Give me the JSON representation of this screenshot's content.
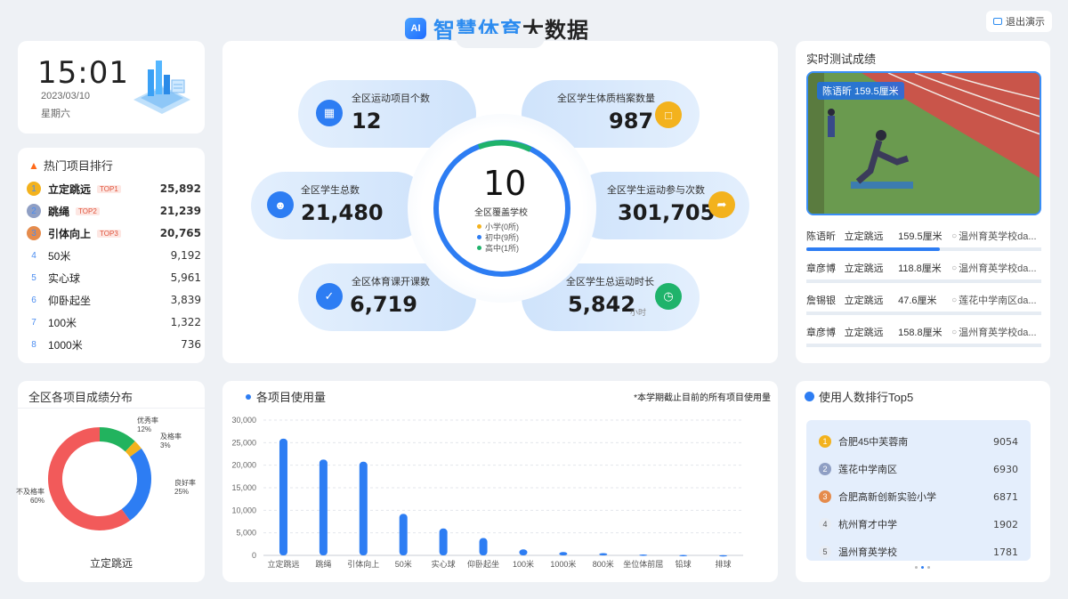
{
  "header": {
    "title_part1": "智慧体育",
    "title_part2": "大数据",
    "ai_badge": "AI",
    "exit_label": "退出演示"
  },
  "clock": {
    "time": "15:01",
    "date": "2023/03/10",
    "weekday": "星期六"
  },
  "hot_ranking": {
    "title": "热门项目排行",
    "items": [
      {
        "rank": "1",
        "name": "立定跳远",
        "tag": "TOP1",
        "value": "25,892"
      },
      {
        "rank": "2",
        "name": "跳绳",
        "tag": "TOP2",
        "value": "21,239"
      },
      {
        "rank": "3",
        "name": "引体向上",
        "tag": "TOP3",
        "value": "20,765"
      },
      {
        "rank": "4",
        "name": "50米",
        "tag": "",
        "value": "9,192"
      },
      {
        "rank": "5",
        "name": "实心球",
        "tag": "",
        "value": "5,961"
      },
      {
        "rank": "6",
        "name": "仰卧起坐",
        "tag": "",
        "value": "3,839"
      },
      {
        "rank": "7",
        "name": "100米",
        "tag": "",
        "value": "1,322"
      },
      {
        "rank": "8",
        "name": "1000米",
        "tag": "",
        "value": "736"
      }
    ],
    "medal_colors": [
      "#f3b21d",
      "#8f9fc4",
      "#e58b4c"
    ]
  },
  "stats": {
    "projects": {
      "label": "全区运动项目个数",
      "value": "12"
    },
    "archives": {
      "label": "全区学生体质档案数量",
      "value": "987"
    },
    "students": {
      "label": "全区学生总数",
      "value": "21,480"
    },
    "participation": {
      "label": "全区学生运动参与次数",
      "value": "301,705"
    },
    "pe_classes": {
      "label": "全区体育课开课数",
      "value": "6,719"
    },
    "duration": {
      "label": "全区学生总运动时长",
      "value": "5,842",
      "unit": "小时"
    },
    "coverage": {
      "value": "10",
      "label": "全区覆盖学校",
      "legend": [
        {
          "text": "小学(0所)",
          "color": "#f3b21d"
        },
        {
          "text": "初中(9所)",
          "color": "#2d7df3"
        },
        {
          "text": "高中(1所)",
          "color": "#1fb36b"
        }
      ]
    }
  },
  "realtime": {
    "title": "实时测试成绩",
    "video_label": "陈语昕  159.5厘米",
    "rows": [
      {
        "name": "陈语昕",
        "project": "立定跳远",
        "score": "159.5厘米",
        "school": "温州育英学校da...",
        "bar": 0.6
      },
      {
        "name": "章彦博",
        "project": "立定跳远",
        "score": "118.8厘米",
        "school": "温州育英学校da..."
      },
      {
        "name": "詹锡银",
        "project": "立定跳远",
        "score": "47.6厘米",
        "school": "莲花中学南区da..."
      },
      {
        "name": "章彦博",
        "project": "立定跳远",
        "score": "158.8厘米",
        "school": "温州育英学校da..."
      }
    ]
  },
  "distribution": {
    "title": "全区各项目成绩分布",
    "project": "立定跳远",
    "labels": {
      "excellent": "优秀率",
      "excellent_pct": "12%",
      "pass": "及格率",
      "pass_pct": "3%",
      "good": "良好率",
      "good_pct": "25%",
      "fail": "不及格率",
      "fail_pct": "60%"
    }
  },
  "usage": {
    "title": "各项目使用量",
    "note": "*本学期截止目前的所有项目使用量"
  },
  "top5": {
    "title": "使用人数排行Top5",
    "items": [
      {
        "rank": "1",
        "name": "合肥45中芙蓉南",
        "value": "9054"
      },
      {
        "rank": "2",
        "name": "莲花中学南区",
        "value": "6930"
      },
      {
        "rank": "3",
        "name": "合肥高新创新实验小学",
        "value": "6871"
      },
      {
        "rank": "4",
        "name": "杭州育才中学",
        "value": "1902"
      },
      {
        "rank": "5",
        "name": "温州育英学校",
        "value": "1781"
      }
    ]
  },
  "chart_data": [
    {
      "type": "bar",
      "title": "各项目使用量",
      "categories": [
        "立定跳远",
        "跳绳",
        "引体向上",
        "50米",
        "实心球",
        "仰卧起坐",
        "100米",
        "1000米",
        "800米",
        "坐位体前屈",
        "铅球",
        "排球"
      ],
      "values": [
        25892,
        21239,
        20765,
        9192,
        5961,
        3839,
        1322,
        736,
        500,
        200,
        100,
        50
      ],
      "yticks": [
        "0",
        "5,000",
        "10,000",
        "15,000",
        "20,000",
        "25,000",
        "30,000"
      ],
      "ylim": [
        0,
        30000
      ],
      "color": "#2d7df3"
    },
    {
      "type": "pie",
      "title": "全区各项目成绩分布",
      "categories": [
        "优秀率",
        "及格率",
        "良好率",
        "不及格率"
      ],
      "values": [
        12,
        3,
        25,
        60
      ],
      "colors": [
        "#22b35e",
        "#f3b21d",
        "#2d7df3",
        "#f25a5a"
      ]
    }
  ]
}
